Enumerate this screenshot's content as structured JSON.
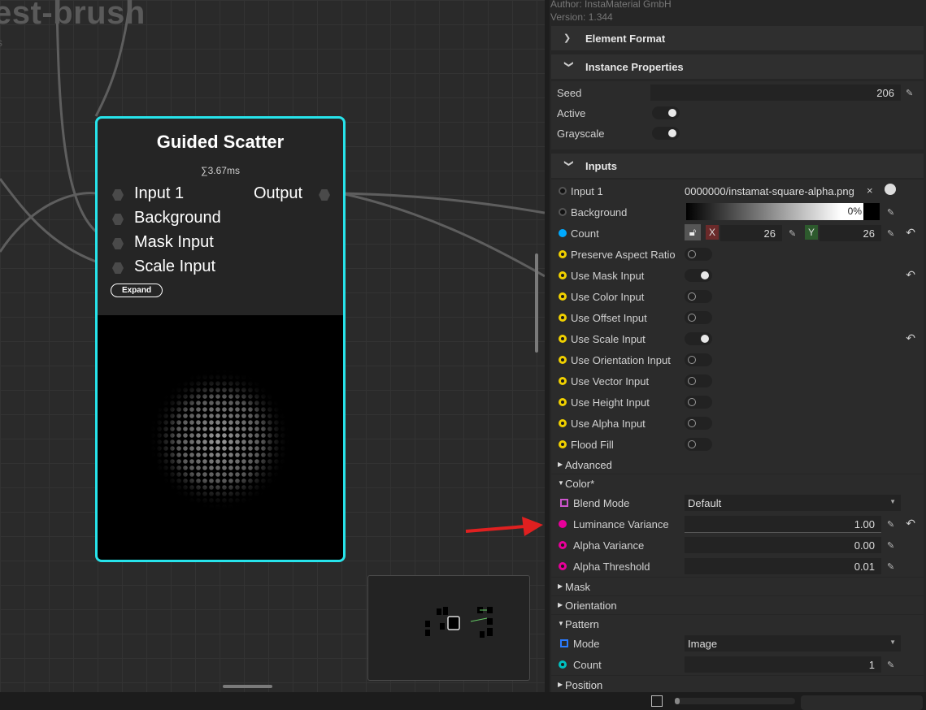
{
  "graph": {
    "title": "est-brush",
    "subtitle": "s",
    "node": {
      "title": "Guided Scatter",
      "time": "∑3.67ms",
      "inputs": [
        "Input 1",
        "Background",
        "Mask Input",
        "Scale Input"
      ],
      "output": "Output",
      "expand_label": "Expand"
    }
  },
  "panel": {
    "author": "Author: InstaMaterial GmbH",
    "version": "Version: 1.344",
    "sections": {
      "element_format": "Element Format",
      "instance_properties": "Instance Properties",
      "inputs": "Inputs"
    },
    "instance": {
      "seed_label": "Seed",
      "seed_value": "206",
      "active_label": "Active",
      "grayscale_label": "Grayscale"
    },
    "inputs": {
      "input1_label": "Input 1",
      "input1_value": "0000000/instamat-square-alpha.png",
      "background_label": "Background",
      "background_value": "0%",
      "count_label": "Count",
      "count_x_label": "X",
      "count_x": "26",
      "count_y_label": "Y",
      "count_y": "26",
      "toggles": [
        {
          "label": "Preserve Aspect Ratio",
          "on": false,
          "undo": false
        },
        {
          "label": "Use Mask Input",
          "on": true,
          "undo": true
        },
        {
          "label": "Use Color Input",
          "on": false,
          "undo": false
        },
        {
          "label": "Use Offset Input",
          "on": false,
          "undo": false
        },
        {
          "label": "Use Scale Input",
          "on": true,
          "undo": true
        },
        {
          "label": "Use Orientation Input",
          "on": false,
          "undo": false
        },
        {
          "label": "Use Vector Input",
          "on": false,
          "undo": false
        },
        {
          "label": "Use Height Input",
          "on": false,
          "undo": false
        },
        {
          "label": "Use Alpha Input",
          "on": false,
          "undo": false
        },
        {
          "label": "Flood Fill",
          "on": false,
          "undo": false
        }
      ]
    },
    "advanced": "Advanced",
    "color": {
      "title": "Color*",
      "blend_mode_label": "Blend Mode",
      "blend_mode_value": "Default",
      "luminance_label": "Luminance Variance",
      "luminance_value": "1.00",
      "alpha_var_label": "Alpha Variance",
      "alpha_var_value": "0.00",
      "alpha_thr_label": "Alpha Threshold",
      "alpha_thr_value": "0.01"
    },
    "mask": "Mask",
    "orientation": "Orientation",
    "pattern": {
      "title": "Pattern",
      "mode_label": "Mode",
      "mode_value": "Image",
      "count_label": "Count",
      "count_value": "1"
    },
    "position": "Position"
  },
  "colors": {
    "node_border": "#27e3ea",
    "annotation_arrow": "#e02020",
    "toggle_input_dot": "#f0d000",
    "color_param_dot": "#e8009a"
  }
}
